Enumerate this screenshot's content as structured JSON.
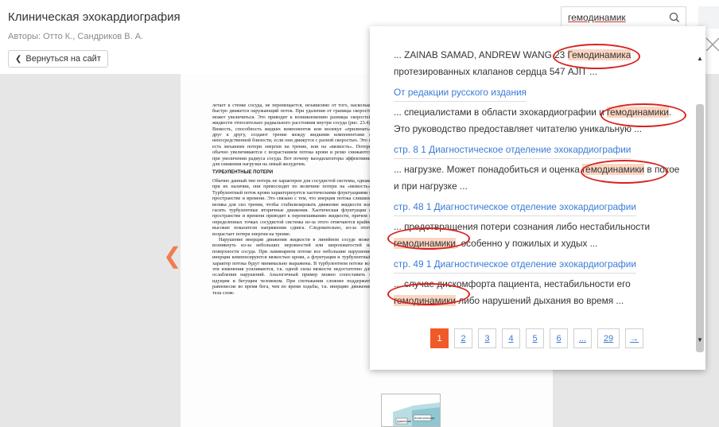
{
  "header": {
    "title": "Клиническая эхокардиография",
    "authors": "Авторы: Отто К., Сандриков В. А.",
    "back_label": "Вернуться на сайт"
  },
  "search": {
    "value": "гемодинамик",
    "icon": "search-icon"
  },
  "results": [
    {
      "parts": [
        {
          "t": "... ZAINAB SAMAD, ANDREW WANG 23 ",
          "h": false
        },
        {
          "t": "Гемодинамика",
          "h": true
        }
      ],
      "line2": "протезированных клапанов сердца 547 AJIT ..."
    },
    {
      "link": "От редакции русского издания",
      "parts": [
        {
          "t": "... специалистами в области эхокардиографии и ",
          "h": false
        },
        {
          "t": "гемодинамики",
          "h": true
        },
        {
          "t": ".",
          "h": false
        }
      ],
      "line2": "Это руководство предоставляет читателю уникальную ..."
    },
    {
      "link": "стр. 8 1 Диагностическое отделение эхокардиографии",
      "parts": [
        {
          "t": "... нагрузке. Может понадобиться и оценка ",
          "h": false
        },
        {
          "t": "гемодинамики",
          "h": true
        },
        {
          "t": " в покое",
          "h": false
        }
      ],
      "line2": "и при нагрузке ..."
    },
    {
      "link": "стр. 48 1 Диагностическое отделение эхокардиографии",
      "line1": "... предотвращения потери сознания либо нестабильности",
      "parts": [
        {
          "t": "гемодинамики",
          "h": true
        },
        {
          "t": ", особенно у пожилых и худых ...",
          "h": false
        }
      ]
    },
    {
      "link": "стр. 49 1 Диагностическое отделение эхокардиографии",
      "line1": "... случае дискомфорта пациента, нестабильности его",
      "parts": [
        {
          "t": "гемодинамики",
          "h": true
        },
        {
          "t": " либо нарушений дыхания во время ...",
          "h": false
        }
      ]
    }
  ],
  "pagination": {
    "pages": [
      "1",
      "2",
      "3",
      "4",
      "5",
      "6",
      "...",
      "29"
    ],
    "active": "1",
    "next": "→"
  },
  "book_page": {
    "para1": "летает к стенке сосуда, не перемещается, независимо от того, насколько быстро движется окружающий поток. При удалении от границы скорость может увеличиться. Это приводит к возникновению разницы скоростей жидкости относительно радиального расстояния внутри сосуда (рис. 23.4). Вязкость, способность жидких компонентов или молекул «прилипать» друг к другу, создают трение между жидкими компонентами в непосредственной близости, если они движутся с разной скоростью. Это и есть механизм потери энергии на трение, или на «вязкость». Потери обычно увеличиваются с возрастанием потока крови и резко снижаются при увеличении радиуса сосуда. Вот почему вазодилататоры эффективны для снижения нагрузки на левый желудочек.",
    "subhead": "ТУРБУЛЕНТНЫЕ ПОТЕРИ",
    "para2": "Обычно данный тип потерь не характерен для сосудистой системы, однако при их наличии, они превосходят по величине потери на «вязкость». Турбулентный поток крови характеризуется хаотическими флуктуациями в пространстве и времени. Это связано с тем, что инерция потока слишком велика для сил трения, чтобы стабилизировать движение жидкости или гасить турбулентные вторичные движения. Хаотическая флуктуация в пространстве и времени приводит к перемешиванию жидкости, причем в определенных точках сосудистой системы из-за этого отмечаются крайне высокие показатели напряжения сдвига. Следовательно, из-за этого возрастает потеря энергии на трение.",
    "para3": "Нарушение инерции движения жидкости в линейном сосуде может возникнуть из-за небольших неровностей или шероховатостей на поверхности сосуда. При ламинарном потоке все небольшие нарушения инерции компенсируются вязкостью крови, а флуктуация и турбулентный характер потока будут минимально выражены. В турбулентном потоке все эти изменения усиливаются, т.к. одной силы вязкости недостаточно для ослабления нарушений. Аналогичный пример можно сопоставить с идущим и бегущим человеком. При спотыкании сложнее поддержать равновесие во время бега, чем во время ходьбы, т.к. инерцию движения тела слож-",
    "figure_labels": [
      "Давление",
      "Кинетическая"
    ]
  }
}
